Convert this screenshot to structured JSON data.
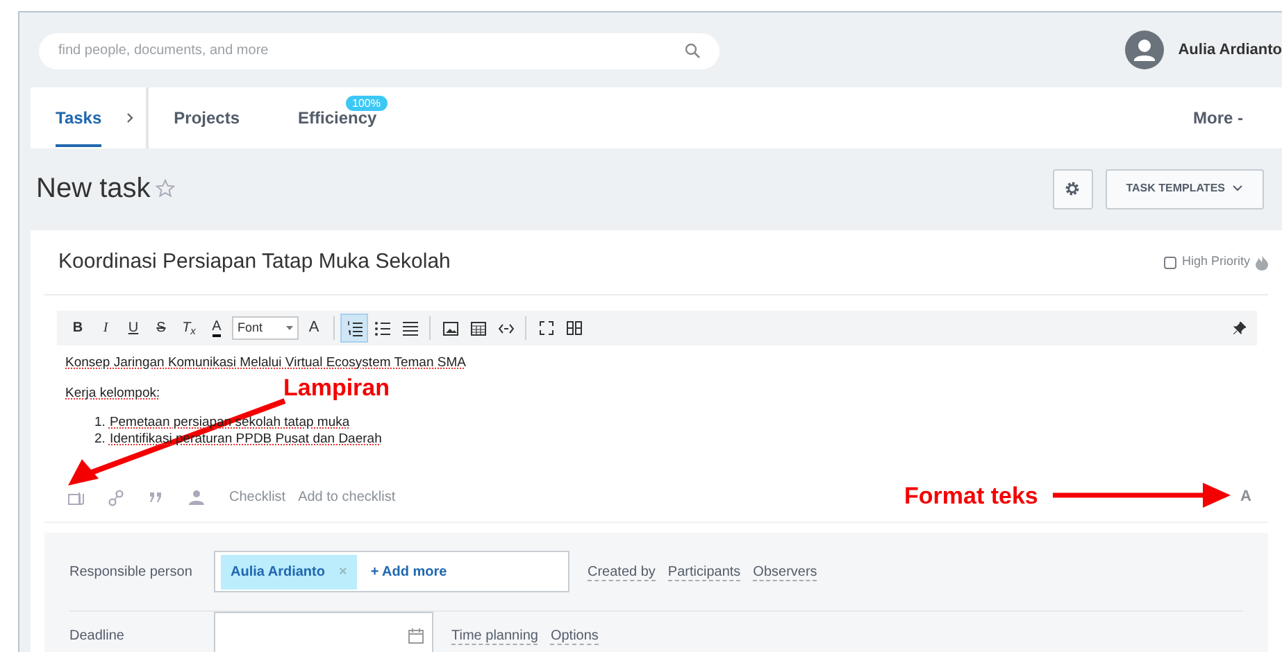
{
  "search": {
    "placeholder": "find people, documents, and more"
  },
  "user": {
    "name": "Aulia Ardianto"
  },
  "tabs": [
    {
      "label": "Tasks",
      "selected": true
    },
    {
      "label": "Projects",
      "selected": false
    },
    {
      "label": "Efficiency",
      "selected": false,
      "badge": "100%"
    }
  ],
  "more": "More -",
  "page_title": "New task",
  "templates_button": "TASK TEMPLATES",
  "task": {
    "title": "Koordinasi Persiapan Tatap Muka Sekolah",
    "high_priority": {
      "label": "High Priority",
      "checked": false
    }
  },
  "toolbar": [
    {
      "kind": "bold",
      "label": "B",
      "active": false
    },
    {
      "kind": "italic",
      "label": "I",
      "active": false
    },
    {
      "kind": "underline",
      "label": "U",
      "active": false
    },
    {
      "kind": "strike",
      "label": "S",
      "active": false
    },
    {
      "kind": "clear",
      "label": "T$_{x}$",
      "active": false
    },
    {
      "kind": "color",
      "label": "A",
      "active": false
    },
    {
      "kind": "select",
      "label": "Font",
      "active": false
    },
    {
      "kind": "size",
      "label": "A",
      "active": false
    },
    {
      "kind": "separator"
    },
    {
      "kind": "numbered-list",
      "active": true
    },
    {
      "kind": "bullet-list",
      "active": false
    },
    {
      "kind": "align",
      "active": false
    },
    {
      "kind": "separator"
    },
    {
      "kind": "image",
      "active": false
    },
    {
      "kind": "table",
      "active": false
    },
    {
      "kind": "code",
      "active": false
    },
    {
      "kind": "separator"
    },
    {
      "kind": "fullscreen",
      "active": false
    },
    {
      "kind": "bbcode",
      "active": false
    }
  ],
  "content": [
    {
      "kind": "paragraph",
      "text": "Konsep Jaringan Komunikasi Melalui Virtual Ecosystem Teman SMA"
    },
    {
      "kind": "paragraph",
      "text": "Kerja kelompok:"
    },
    {
      "kind": "list",
      "items": [
        {
          "number": "1.",
          "text": "Pemetaan persiapan sekolah tatap muka"
        },
        {
          "number": "2.",
          "text": "Identifikasi peraturan PPDB Pusat dan Daerah"
        }
      ]
    }
  ],
  "footer_tools": [
    {
      "kind": "attachment"
    },
    {
      "kind": "link"
    },
    {
      "kind": "quote"
    },
    {
      "kind": "person"
    },
    {
      "kind": "text",
      "label": "Checklist"
    },
    {
      "kind": "text",
      "label": "Add to checklist"
    }
  ],
  "format_button": "A",
  "fields": [
    {
      "label": "Responsible person",
      "kind": "people",
      "tags": [
        "Aulia Ardianto"
      ],
      "tag_remove": "×",
      "add": "+ Add more",
      "links": [
        "Created by",
        "Participants",
        "Observers"
      ]
    },
    {
      "label": "Deadline",
      "kind": "date",
      "links": [
        "Time planning",
        "Options"
      ]
    }
  ],
  "annotations": [
    {
      "kind": "lampiran",
      "text": "Lampiran"
    },
    {
      "kind": "format",
      "text": "Format teks"
    }
  ]
}
